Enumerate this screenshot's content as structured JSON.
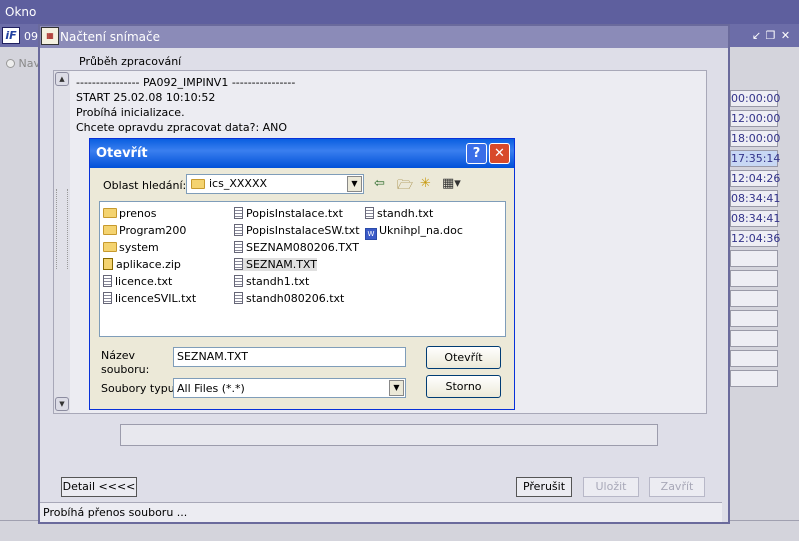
{
  "app": {
    "window_title": "Okno",
    "inner_title_fragment": "09",
    "nav_radio_label": "Nav",
    "times": [
      "00:00:00",
      "12:00:00",
      "18:00:00",
      "17:35:14",
      "12:04:26",
      "08:34:41",
      "08:34:41",
      "12:04:36"
    ]
  },
  "loader": {
    "title": "Načtení snímače",
    "progress_section_label": "Průběh zpracování",
    "log_lines": [
      "---------------- PA092_IMPINV1 ----------------",
      "START 25.02.08 10:10:52",
      "Probíhá inicializace.",
      "Chcete opravdu zpracovat data?: ANO"
    ],
    "detail_button": "Detail  <<<<",
    "cancel_button": "Přerušit",
    "save_button": "Uložit",
    "close_button": "Zavřít",
    "status": "Probíhá přenos souboru ..."
  },
  "open_dialog": {
    "title": "Otevřít",
    "look_in_label": "Oblast hledání:",
    "look_in_value": "ics_XXXXX",
    "files": [
      {
        "name": "prenos",
        "type": "folder"
      },
      {
        "name": "Program200",
        "type": "folder"
      },
      {
        "name": "system",
        "type": "folder"
      },
      {
        "name": "aplikace.zip",
        "type": "zip"
      },
      {
        "name": "licence.txt",
        "type": "txt"
      },
      {
        "name": "licenceSVIL.txt",
        "type": "txt"
      },
      {
        "name": "PopisInstalace.txt",
        "type": "txt"
      },
      {
        "name": "PopisInstalaceSW.txt",
        "type": "txt"
      },
      {
        "name": "SEZNAM080206.TXT",
        "type": "txt"
      },
      {
        "name": "SEZNAM.TXT",
        "type": "txt",
        "selected": true
      },
      {
        "name": "standh1.txt",
        "type": "txt"
      },
      {
        "name": "standh080206.txt",
        "type": "txt"
      },
      {
        "name": "standh.txt",
        "type": "txt"
      },
      {
        "name": "Uknihpl_na.doc",
        "type": "doc"
      }
    ],
    "filename_label_line1": "Název",
    "filename_label_line2": "souboru:",
    "filename_value": "SEZNAM.TXT",
    "filetype_label": "Soubory typu:",
    "filetype_value": "All Files (*.*)",
    "open_button": "Otevřít",
    "cancel_button": "Storno"
  }
}
